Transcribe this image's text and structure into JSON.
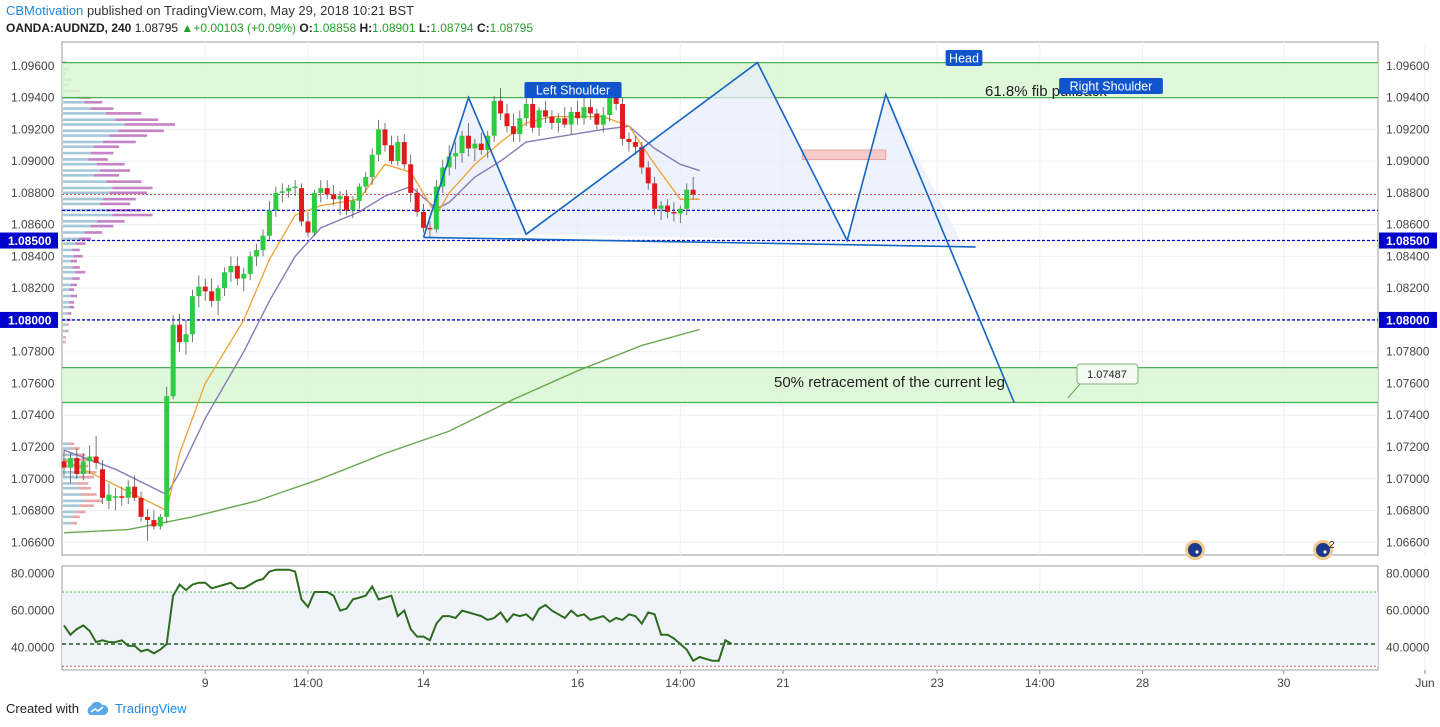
{
  "header": {
    "author": "CBMotivation",
    "published": "published on TradingView.com, May 29, 2018 10:21 BST",
    "symbol": "OANDA:AUDNZD, 240",
    "last": "1.08795",
    "change": "+0.00103 (+0.09%)",
    "o_label": "O:",
    "o_value": "1.08858",
    "h_label": "H:",
    "h_value": "1.08901",
    "l_label": "L:",
    "l_value": "1.08794",
    "c_label": "C:",
    "c_value": "1.08795"
  },
  "footer": {
    "created_with": "Created with",
    "brand": "TradingView"
  },
  "colors": {
    "up": "#2ecc40",
    "down": "#e01b1b",
    "zone_fill": "#d9f7d4",
    "zone_line": "#4caf50",
    "pattern": "#1565c0",
    "ma_orange": "#f0a030",
    "ma_purple": "#8a7ab8",
    "ma_green": "#6aa84f",
    "level": "#0000cc",
    "label_bg": "#1155cc",
    "rsi_line": "#2e6b1f"
  },
  "chart_data": {
    "type": "candlestick",
    "y_ticks": [
      "1.09600",
      "1.09400",
      "1.09200",
      "1.09000",
      "1.08800",
      "1.08600",
      "1.08500",
      "1.08400",
      "1.08200",
      "1.08000",
      "1.07800",
      "1.07600",
      "1.07400",
      "1.07200",
      "1.07000",
      "1.06800",
      "1.06600"
    ],
    "ylim": [
      1.0652,
      1.0975
    ],
    "x_ticks": [
      {
        "label": "9",
        "t": 22
      },
      {
        "label": "14:00",
        "t": 38
      },
      {
        "label": "14",
        "t": 56
      },
      {
        "label": "16",
        "t": 80
      },
      {
        "label": "14:00",
        "t": 96
      },
      {
        "label": "21",
        "t": 112
      },
      {
        "label": "23",
        "t": 136
      },
      {
        "label": "14:00",
        "t": 152
      },
      {
        "label": "28",
        "t": 168
      },
      {
        "label": "30",
        "t": 190
      },
      {
        "label": "Jun",
        "t": 212
      }
    ],
    "candles": [
      [
        1.0711,
        1.0718,
        1.0702,
        1.0707
      ],
      [
        1.0707,
        1.0716,
        1.0697,
        1.0713
      ],
      [
        1.0713,
        1.0719,
        1.07,
        1.0703
      ],
      [
        1.0703,
        1.0716,
        1.0699,
        1.0711
      ],
      [
        1.0711,
        1.0721,
        1.0703,
        1.0714
      ],
      [
        1.0714,
        1.0727,
        1.0706,
        1.071
      ],
      [
        1.0706,
        1.0712,
        1.0684,
        1.0688
      ],
      [
        1.0686,
        1.0697,
        1.0681,
        1.069
      ],
      [
        1.0688,
        1.0694,
        1.068,
        1.0689
      ],
      [
        1.0689,
        1.0695,
        1.0683,
        1.0688
      ],
      [
        1.0688,
        1.0699,
        1.0684,
        1.0695
      ],
      [
        1.0695,
        1.0702,
        1.0686,
        1.0688
      ],
      [
        1.0688,
        1.0692,
        1.0673,
        1.0676
      ],
      [
        1.0676,
        1.0681,
        1.0661,
        1.0674
      ],
      [
        1.0674,
        1.068,
        1.0668,
        1.067
      ],
      [
        1.067,
        1.0678,
        1.0668,
        1.0676
      ],
      [
        1.0676,
        1.0758,
        1.0672,
        1.0752
      ],
      [
        1.0752,
        1.0803,
        1.075,
        1.0797
      ],
      [
        1.0797,
        1.0804,
        1.078,
        1.0786
      ],
      [
        1.0786,
        1.08,
        1.0778,
        1.0791
      ],
      [
        1.0791,
        1.0819,
        1.0786,
        1.0815
      ],
      [
        1.0815,
        1.0828,
        1.0808,
        1.0821
      ],
      [
        1.0821,
        1.0826,
        1.0812,
        1.0818
      ],
      [
        1.0818,
        1.0826,
        1.0808,
        1.0812
      ],
      [
        1.0812,
        1.0822,
        1.0803,
        1.082
      ],
      [
        1.082,
        1.0833,
        1.0815,
        1.083
      ],
      [
        1.083,
        1.084,
        1.0824,
        1.0834
      ],
      [
        1.0834,
        1.084,
        1.0822,
        1.0826
      ],
      [
        1.0826,
        1.0833,
        1.0818,
        1.0829
      ],
      [
        1.0829,
        1.0843,
        1.0825,
        1.084
      ],
      [
        1.084,
        1.0848,
        1.0834,
        1.0844
      ],
      [
        1.0844,
        1.0857,
        1.084,
        1.0853
      ],
      [
        1.0853,
        1.0875,
        1.085,
        1.0869
      ],
      [
        1.0869,
        1.0884,
        1.0865,
        1.088
      ],
      [
        1.088,
        1.0886,
        1.0874,
        1.0881
      ],
      [
        1.0881,
        1.0885,
        1.0877,
        1.0883
      ],
      [
        1.0883,
        1.0888,
        1.0878,
        1.0884
      ],
      [
        1.0883,
        1.0886,
        1.0859,
        1.0862
      ],
      [
        1.0862,
        1.0868,
        1.0852,
        1.0855
      ],
      [
        1.0855,
        1.0882,
        1.0853,
        1.088
      ],
      [
        1.088,
        1.0888,
        1.0874,
        1.0883
      ],
      [
        1.0883,
        1.0888,
        1.0876,
        1.0879
      ],
      [
        1.0879,
        1.0885,
        1.0872,
        1.0876
      ],
      [
        1.0876,
        1.0881,
        1.0866,
        1.0878
      ],
      [
        1.0878,
        1.0882,
        1.0866,
        1.0869
      ],
      [
        1.0869,
        1.0878,
        1.0864,
        1.0875
      ],
      [
        1.0875,
        1.0886,
        1.087,
        1.0884
      ],
      [
        1.0884,
        1.0893,
        1.088,
        1.089
      ],
      [
        1.089,
        1.0908,
        1.0885,
        1.0904
      ],
      [
        1.0904,
        1.0926,
        1.09,
        1.092
      ],
      [
        1.092,
        1.0924,
        1.0906,
        1.091
      ],
      [
        1.091,
        1.0916,
        1.0898,
        1.09
      ],
      [
        1.09,
        1.0916,
        1.0897,
        1.0912
      ],
      [
        1.0912,
        1.0917,
        1.0895,
        1.0898
      ],
      [
        1.0898,
        1.0904,
        1.0874,
        1.088
      ],
      [
        1.088,
        1.0883,
        1.0865,
        1.0868
      ],
      [
        1.0868,
        1.0873,
        1.0855,
        1.0858
      ],
      [
        1.0858,
        1.0862,
        1.0852,
        1.0857
      ],
      [
        1.0857,
        1.0888,
        1.0855,
        1.0884
      ],
      [
        1.0884,
        1.0901,
        1.088,
        1.0896
      ],
      [
        1.0896,
        1.091,
        1.0891,
        1.0903
      ],
      [
        1.0903,
        1.0912,
        1.0895,
        1.0905
      ],
      [
        1.0905,
        1.0919,
        1.0899,
        1.0916
      ],
      [
        1.0916,
        1.0924,
        1.0903,
        1.0908
      ],
      [
        1.0908,
        1.0914,
        1.09,
        1.0911
      ],
      [
        1.0911,
        1.0918,
        1.0904,
        1.0907
      ],
      [
        1.0907,
        1.0919,
        1.0902,
        1.0916
      ],
      [
        1.0916,
        1.0941,
        1.0912,
        1.0938
      ],
      [
        1.0938,
        1.0946,
        1.0926,
        1.093
      ],
      [
        1.093,
        1.0936,
        1.0918,
        1.0922
      ],
      [
        1.0922,
        1.093,
        1.0912,
        1.0917
      ],
      [
        1.0917,
        1.0932,
        1.0912,
        1.0927
      ],
      [
        1.0927,
        1.094,
        1.0922,
        1.0936
      ],
      [
        1.0936,
        1.0942,
        1.0918,
        1.0921
      ],
      [
        1.0921,
        1.0934,
        1.0916,
        1.0932
      ],
      [
        1.0932,
        1.0938,
        1.0924,
        1.0928
      ],
      [
        1.0928,
        1.0932,
        1.092,
        1.0924
      ],
      [
        1.0924,
        1.093,
        1.0918,
        1.0927
      ],
      [
        1.0927,
        1.0934,
        1.0921,
        1.0923
      ],
      [
        1.0923,
        1.0934,
        1.0917,
        1.0931
      ],
      [
        1.0931,
        1.0938,
        1.0923,
        1.0927
      ],
      [
        1.0927,
        1.094,
        1.0923,
        1.0934
      ],
      [
        1.0934,
        1.0939,
        1.0926,
        1.093
      ],
      [
        1.093,
        1.0933,
        1.092,
        1.0923
      ],
      [
        1.0923,
        1.0934,
        1.0918,
        1.0929
      ],
      [
        1.0929,
        1.0946,
        1.0925,
        1.094
      ],
      [
        1.094,
        1.0944,
        1.0932,
        1.0936
      ],
      [
        1.0936,
        1.094,
        1.091,
        1.0914
      ],
      [
        1.0914,
        1.0918,
        1.0906,
        1.0912
      ],
      [
        1.0912,
        1.0916,
        1.0904,
        1.0909
      ],
      [
        1.0909,
        1.0912,
        1.0892,
        1.0896
      ],
      [
        1.0896,
        1.09,
        1.0882,
        1.0886
      ],
      [
        1.0886,
        1.089,
        1.0866,
        1.087
      ],
      [
        1.087,
        1.0875,
        1.0863,
        1.0872
      ],
      [
        1.0872,
        1.0876,
        1.0864,
        1.0868
      ],
      [
        1.0868,
        1.0874,
        1.0862,
        1.0867
      ],
      [
        1.0867,
        1.0872,
        1.0861,
        1.087
      ],
      [
        1.087,
        1.0886,
        1.0866,
        1.0882
      ],
      [
        1.0882,
        1.089,
        1.0876,
        1.0879
      ]
    ],
    "ma_orange": [
      [
        0,
        1.0712
      ],
      [
        6,
        1.07
      ],
      [
        12,
        1.0688
      ],
      [
        16,
        1.068
      ],
      [
        18,
        1.0716
      ],
      [
        22,
        1.076
      ],
      [
        28,
        1.08
      ],
      [
        32,
        1.0838
      ],
      [
        36,
        1.0866
      ],
      [
        40,
        1.0872
      ],
      [
        46,
        1.0876
      ],
      [
        50,
        1.0898
      ],
      [
        54,
        1.0893
      ],
      [
        58,
        1.0866
      ],
      [
        60,
        1.088
      ],
      [
        64,
        1.0898
      ],
      [
        68,
        1.0912
      ],
      [
        72,
        1.0924
      ],
      [
        76,
        1.0928
      ],
      [
        84,
        1.0928
      ],
      [
        88,
        1.0922
      ],
      [
        92,
        1.0898
      ],
      [
        96,
        1.0876
      ],
      [
        99,
        1.0876
      ]
    ],
    "ma_purple": [
      [
        0,
        1.0718
      ],
      [
        8,
        1.0706
      ],
      [
        16,
        1.069
      ],
      [
        18,
        1.0704
      ],
      [
        22,
        1.0738
      ],
      [
        28,
        1.078
      ],
      [
        32,
        1.0812
      ],
      [
        36,
        1.084
      ],
      [
        40,
        1.0858
      ],
      [
        46,
        1.0868
      ],
      [
        50,
        1.0878
      ],
      [
        54,
        1.0884
      ],
      [
        58,
        1.087
      ],
      [
        60,
        1.0874
      ],
      [
        64,
        1.089
      ],
      [
        68,
        1.09
      ],
      [
        72,
        1.0912
      ],
      [
        78,
        1.0916
      ],
      [
        84,
        1.092
      ],
      [
        88,
        1.0922
      ],
      [
        92,
        1.0908
      ],
      [
        96,
        1.0898
      ],
      [
        99,
        1.0894
      ]
    ],
    "ma_green": [
      [
        0,
        1.0666
      ],
      [
        10,
        1.0668
      ],
      [
        20,
        1.0676
      ],
      [
        30,
        1.0686
      ],
      [
        40,
        1.07
      ],
      [
        50,
        1.0716
      ],
      [
        60,
        1.073
      ],
      [
        70,
        1.075
      ],
      [
        80,
        1.0768
      ],
      [
        90,
        1.0784
      ],
      [
        99,
        1.0794
      ]
    ],
    "green_zones": [
      [
        1.094,
        1.0962
      ],
      [
        1.0748,
        1.077
      ]
    ],
    "blue_levels": [
      1.0869,
      1.085,
      1.08
    ],
    "red_level": 1.0879,
    "pattern_points": [
      [
        56,
        1.0852
      ],
      [
        63,
        1.094
      ],
      [
        72,
        1.0854
      ],
      [
        108,
        1.0962
      ],
      [
        122,
        1.085
      ],
      [
        128,
        1.0942
      ],
      [
        148,
        1.0748
      ]
    ],
    "neckline": [
      [
        56,
        1.0852
      ],
      [
        142,
        1.0846
      ]
    ],
    "rect_zone": {
      "t0": 115,
      "t1": 128,
      "y0": 1.0901,
      "y1": 1.0907
    },
    "highlighted_labels": [
      "1.08500",
      "1.08000"
    ],
    "annotations": {
      "left_shoulder": "Left Shoulder",
      "head": "Head",
      "right_shoulder": "Right Shoulder",
      "fib": "61.8% fib pullback",
      "retracement": "50% retracement of the current leg",
      "price_tag": "1.07487"
    },
    "event_badge": "2",
    "rsi": {
      "y_ticks": [
        "80.0000",
        "60.0000",
        "40.0000"
      ],
      "ylim": [
        28,
        84
      ],
      "upper": 70,
      "lower": 30,
      "mid": 42,
      "values": [
        [
          0,
          52
        ],
        [
          1,
          47
        ],
        [
          2,
          50
        ],
        [
          3,
          52
        ],
        [
          4,
          49
        ],
        [
          5,
          43
        ],
        [
          6,
          44
        ],
        [
          7,
          43
        ],
        [
          8,
          43
        ],
        [
          9,
          44
        ],
        [
          10,
          41
        ],
        [
          11,
          41
        ],
        [
          12,
          38
        ],
        [
          13,
          39
        ],
        [
          14,
          37
        ],
        [
          15,
          39
        ],
        [
          16,
          42
        ],
        [
          17,
          68
        ],
        [
          18,
          74
        ],
        [
          19,
          71
        ],
        [
          20,
          74
        ],
        [
          21,
          75
        ],
        [
          22,
          75
        ],
        [
          23,
          72
        ],
        [
          24,
          73
        ],
        [
          25,
          74
        ],
        [
          26,
          75
        ],
        [
          27,
          72
        ],
        [
          28,
          72
        ],
        [
          29,
          74
        ],
        [
          30,
          76
        ],
        [
          31,
          77
        ],
        [
          32,
          81
        ],
        [
          33,
          82
        ],
        [
          34,
          82
        ],
        [
          35,
          82
        ],
        [
          36,
          81
        ],
        [
          37,
          66
        ],
        [
          38,
          62
        ],
        [
          39,
          70
        ],
        [
          40,
          70
        ],
        [
          41,
          70
        ],
        [
          42,
          68
        ],
        [
          43,
          60
        ],
        [
          44,
          61
        ],
        [
          45,
          66
        ],
        [
          46,
          67
        ],
        [
          47,
          68
        ],
        [
          48,
          73
        ],
        [
          49,
          66
        ],
        [
          50,
          67
        ],
        [
          51,
          68
        ],
        [
          52,
          57
        ],
        [
          53,
          60
        ],
        [
          54,
          50
        ],
        [
          55,
          46
        ],
        [
          56,
          46
        ],
        [
          57,
          44
        ],
        [
          58,
          53
        ],
        [
          59,
          57
        ],
        [
          60,
          57
        ],
        [
          61,
          56
        ],
        [
          62,
          60
        ],
        [
          63,
          59
        ],
        [
          64,
          58
        ],
        [
          65,
          57
        ],
        [
          66,
          55
        ],
        [
          67,
          56
        ],
        [
          68,
          59
        ],
        [
          69,
          54
        ],
        [
          70,
          58
        ],
        [
          71,
          57
        ],
        [
          72,
          58
        ],
        [
          73,
          55
        ],
        [
          74,
          61
        ],
        [
          75,
          63
        ],
        [
          76,
          60
        ],
        [
          77,
          58
        ],
        [
          78,
          56
        ],
        [
          79,
          60
        ],
        [
          80,
          57
        ],
        [
          81,
          58
        ],
        [
          82,
          55
        ],
        [
          83,
          56
        ],
        [
          84,
          57
        ],
        [
          85,
          54
        ],
        [
          86,
          56
        ],
        [
          87,
          55
        ],
        [
          88,
          58
        ],
        [
          89,
          57
        ],
        [
          90,
          53
        ],
        [
          91,
          59
        ],
        [
          92,
          58
        ],
        [
          93,
          47
        ],
        [
          94,
          47
        ],
        [
          95,
          45
        ],
        [
          96,
          42
        ],
        [
          97,
          39
        ],
        [
          98,
          33
        ],
        [
          99,
          35
        ],
        [
          100,
          34
        ],
        [
          101,
          33
        ],
        [
          102,
          33
        ],
        [
          103,
          44
        ],
        [
          104,
          42
        ]
      ]
    }
  }
}
